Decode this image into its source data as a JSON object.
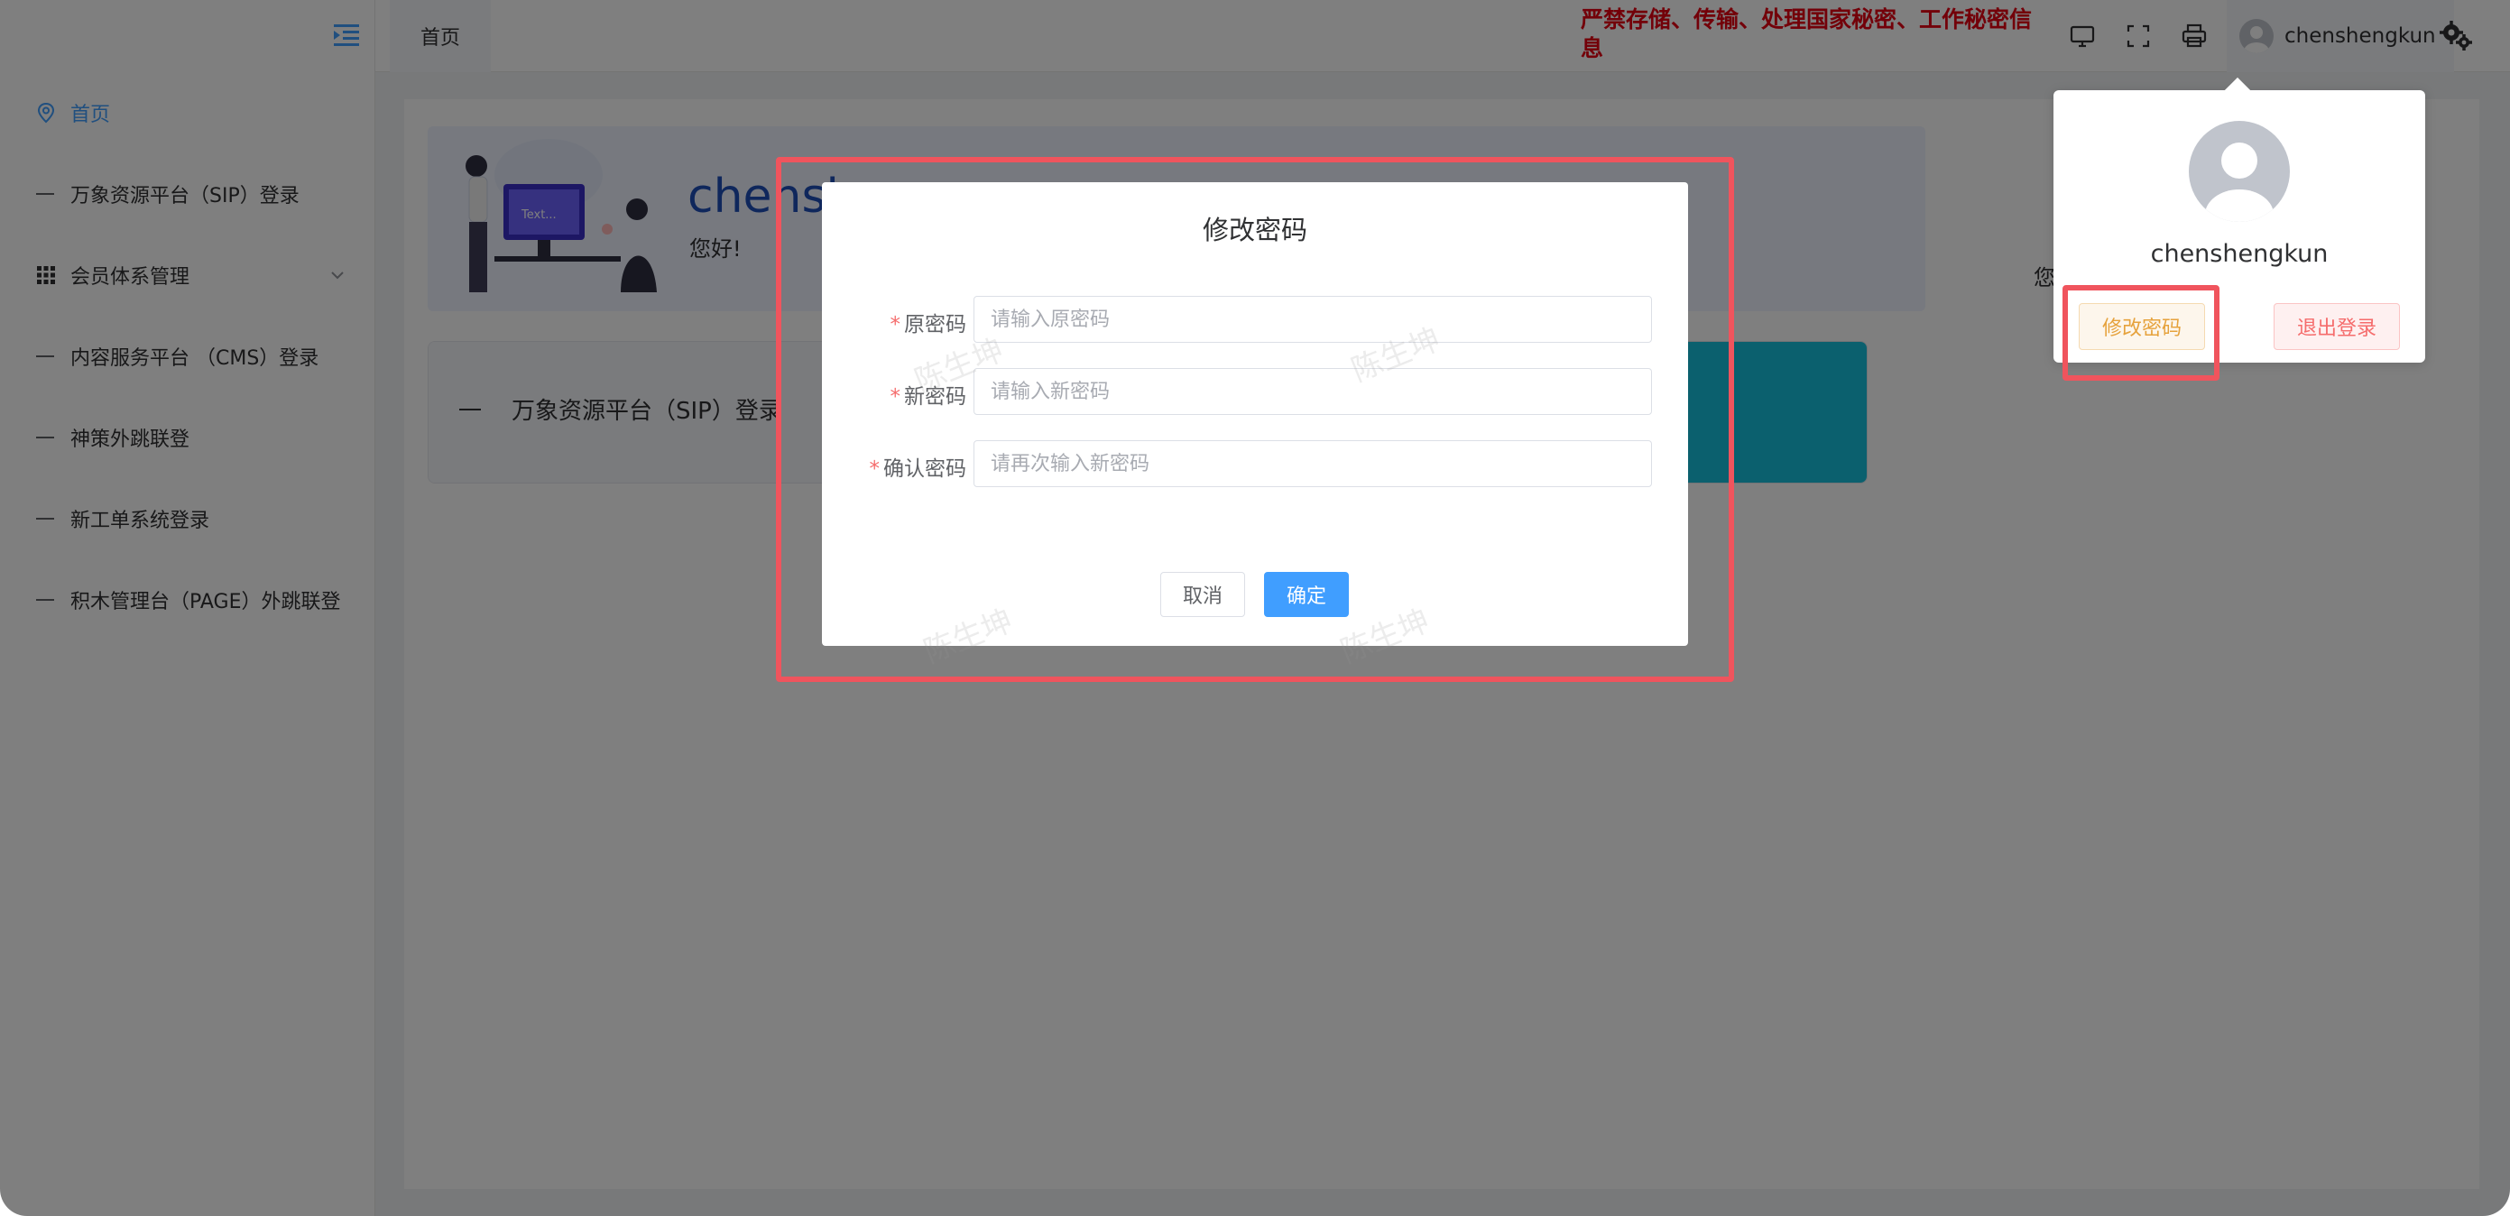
{
  "sidebar": {
    "items": [
      {
        "label": "首页",
        "icon": "location-pin-icon",
        "active": true
      },
      {
        "label": "万象资源平台（SIP）登录"
      },
      {
        "label": "会员体系管理",
        "icon": "grid-icon",
        "expandable": true
      },
      {
        "label": "内容服务平台 （CMS）登录"
      },
      {
        "label": "神策外跳联登"
      },
      {
        "label": "新工单系统登录"
      },
      {
        "label": "积木管理台（PAGE）外跳联登"
      }
    ]
  },
  "topbar": {
    "tab_home": "首页",
    "warning": "严禁存储、传输、处理国家秘密、工作秘密信息",
    "username": "chenshengkun"
  },
  "welcome": {
    "name": "chensh",
    "greeting": "您好!",
    "illustration_text": "Text..."
  },
  "sip_card": {
    "label": "万象资源平台（SIP）登录"
  },
  "side_text": "您",
  "user_panel": {
    "username": "chenshengkun",
    "change_password": "修改密码",
    "logout": "退出登录"
  },
  "dialog": {
    "title": "修改密码",
    "fields": [
      {
        "label": "原密码",
        "placeholder": "请输入原密码"
      },
      {
        "label": "新密码",
        "placeholder": "请输入新密码"
      },
      {
        "label": "确认密码",
        "placeholder": "请再次输入新密码"
      }
    ],
    "cancel": "取消",
    "confirm": "确定"
  },
  "watermark": "陈生坤",
  "colors": {
    "primary": "#409eff",
    "warning_text": "#e60012",
    "annotation": "#f0545d",
    "sip_accent": "#17c1dc"
  }
}
